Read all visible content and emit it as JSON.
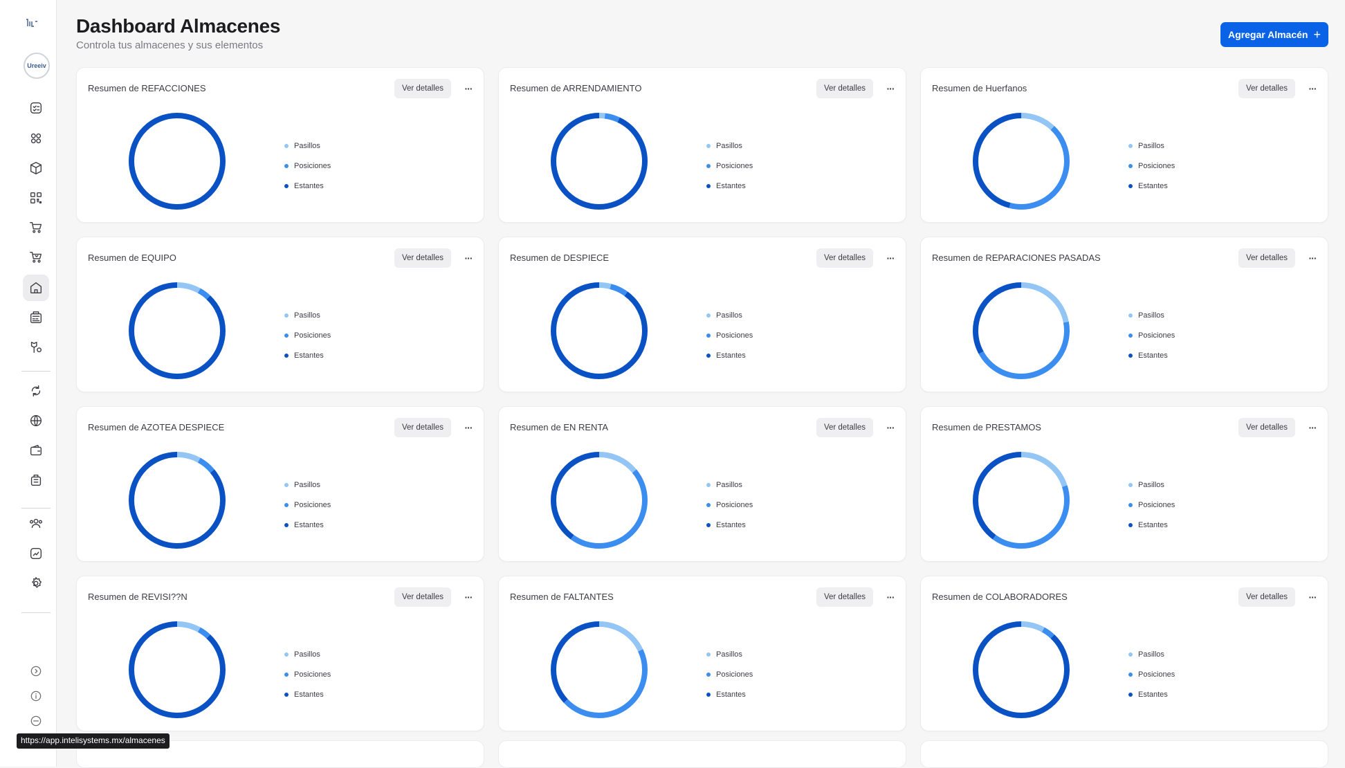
{
  "app": {
    "logo_icon": "intelisystems-logo",
    "avatar_text": "Ureeiv"
  },
  "header": {
    "title": "Dashboard Almacenes",
    "subtitle": "Controla tus almacenes y sus elementos",
    "add_button_label": "Agregar Almacén",
    "add_button_icon": "plus-icon"
  },
  "sidebar": {
    "active_index": 6,
    "items": [
      {
        "name": "checklist-icon"
      },
      {
        "name": "apps-grid-icon"
      },
      {
        "name": "package-icon"
      },
      {
        "name": "qr-code-icon"
      },
      {
        "name": "cart-icon"
      },
      {
        "name": "cart-return-icon"
      },
      {
        "name": "warehouse-home-icon"
      },
      {
        "name": "register-icon"
      },
      {
        "name": "delivery-icon"
      },
      {
        "name": "refresh-cycle-icon"
      },
      {
        "name": "globe-icon"
      },
      {
        "name": "wallet-icon"
      },
      {
        "name": "briefcase-icon"
      },
      {
        "name": "users-icon"
      },
      {
        "name": "chart-doc-icon"
      },
      {
        "name": "settings-icon"
      }
    ],
    "footer_items": [
      {
        "name": "expand-icon"
      },
      {
        "name": "info-icon"
      },
      {
        "name": "minus-circle-icon"
      }
    ]
  },
  "colors": {
    "pasillos": "#93c5f5",
    "posiciones": "#3b8ef0",
    "estantes": "#0a52c4",
    "accent": "#0a63e6"
  },
  "labels": {
    "details_button": "Ver detalles",
    "more_button": "···"
  },
  "legend": [
    "Pasillos",
    "Posiciones",
    "Estantes"
  ],
  "cards": [
    {
      "title": "Resumen de REFACCIONES",
      "chart": {
        "Pasillos": 0,
        "Posiciones": 0,
        "Estantes": 1
      }
    },
    {
      "title": "Resumen de ARRENDAMIENTO",
      "chart": {
        "Pasillos": 0.02,
        "Posiciones": 0.05,
        "Estantes": 0.93
      }
    },
    {
      "title": "Resumen de Huerfanos",
      "chart": {
        "Pasillos": 0.12,
        "Posiciones": 0.42,
        "Estantes": 0.46
      }
    },
    {
      "title": "Resumen de EQUIPO",
      "chart": {
        "Pasillos": 0.08,
        "Posiciones": 0.04,
        "Estantes": 0.88
      }
    },
    {
      "title": "Resumen de DESPIECE",
      "chart": {
        "Pasillos": 0.04,
        "Posiciones": 0.06,
        "Estantes": 0.9
      }
    },
    {
      "title": "Resumen de REPARACIONES PASADAS",
      "chart": {
        "Pasillos": 0.22,
        "Posiciones": 0.45,
        "Estantes": 0.33
      }
    },
    {
      "title": "Resumen de AZOTEA DESPIECE",
      "chart": {
        "Pasillos": 0.08,
        "Posiciones": 0.06,
        "Estantes": 0.86
      }
    },
    {
      "title": "Resumen de EN RENTA",
      "chart": {
        "Pasillos": 0.14,
        "Posiciones": 0.46,
        "Estantes": 0.4
      }
    },
    {
      "title": "Resumen de PRESTAMOS",
      "chart": {
        "Pasillos": 0.2,
        "Posiciones": 0.4,
        "Estantes": 0.4
      }
    },
    {
      "title": "Resumen de REVISI??N",
      "chart": {
        "Pasillos": 0.08,
        "Posiciones": 0.04,
        "Estantes": 0.88
      }
    },
    {
      "title": "Resumen de FALTANTES",
      "chart": {
        "Pasillos": 0.18,
        "Posiciones": 0.45,
        "Estantes": 0.37
      }
    },
    {
      "title": "Resumen de COLABORADORES",
      "chart": {
        "Pasillos": 0.08,
        "Posiciones": 0.04,
        "Estantes": 0.88
      }
    }
  ],
  "status_bar": {
    "url": "https://app.intelisystems.mx/almacenes"
  }
}
